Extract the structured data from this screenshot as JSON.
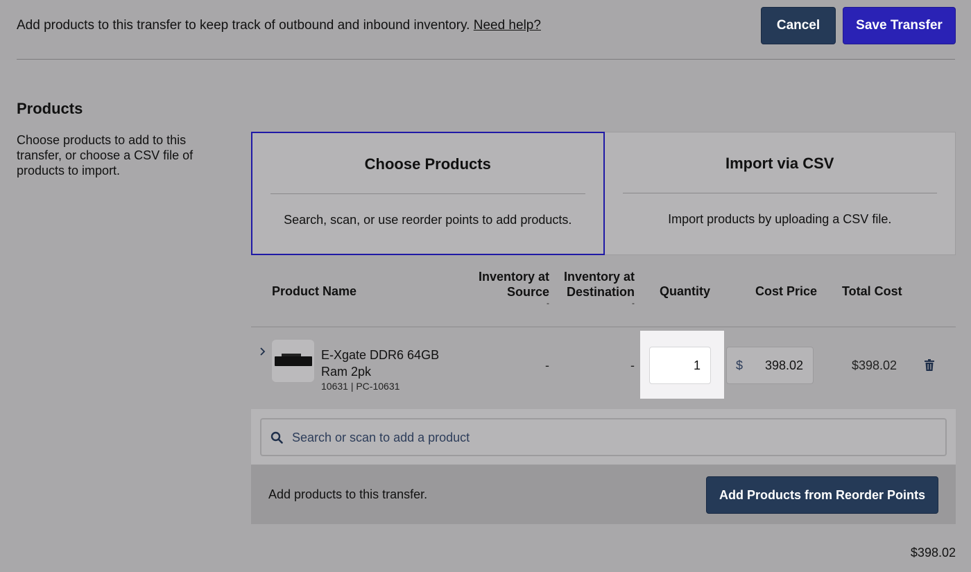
{
  "header": {
    "instruction": "Add products to this transfer to keep track of outbound and inbound inventory.",
    "help_link": "Need help?",
    "cancel_label": "Cancel",
    "save_label": "Save Transfer"
  },
  "section": {
    "title": "Products",
    "description": "Choose products to add to this transfer, or choose a CSV file of products to import."
  },
  "tabs": [
    {
      "title": "Choose Products",
      "description": "Search, scan, or use reorder points to add products.",
      "active": true
    },
    {
      "title": "Import via CSV",
      "description": "Import products by uploading a CSV file.",
      "active": false
    }
  ],
  "table": {
    "columns": {
      "product_name": "Product Name",
      "inv_source": "Inventory at Source",
      "inv_source_line1": "Inventory at",
      "inv_source_line2": "Source",
      "inv_source_sub": "-",
      "inv_dest_line1": "Inventory at",
      "inv_dest_line2": "Destination",
      "inv_dest_sub": "-",
      "quantity": "Quantity",
      "cost_price": "Cost Price",
      "total_cost": "Total Cost"
    },
    "rows": [
      {
        "name": "E-Xgate DDR6 64GB Ram 2pk",
        "sku": "10631 | PC-10631",
        "inv_source": "-",
        "inv_dest": "-",
        "quantity": "1",
        "currency": "$",
        "cost_price": "398.02",
        "total_cost": "$398.02"
      }
    ]
  },
  "search": {
    "placeholder": "Search or scan to add a product"
  },
  "footer": {
    "text": "Add products to this transfer.",
    "reorder_label": "Add Products from Reorder Points"
  },
  "grand_total": "$398.02",
  "icons": {
    "expand": "chevron-right-icon",
    "delete": "trash-icon",
    "search": "search-icon",
    "product_image": "ram-stick-image"
  },
  "colors": {
    "primary_button": "#2a22b5",
    "secondary_button": "#253a57",
    "active_tab_border": "#1f19a6"
  }
}
